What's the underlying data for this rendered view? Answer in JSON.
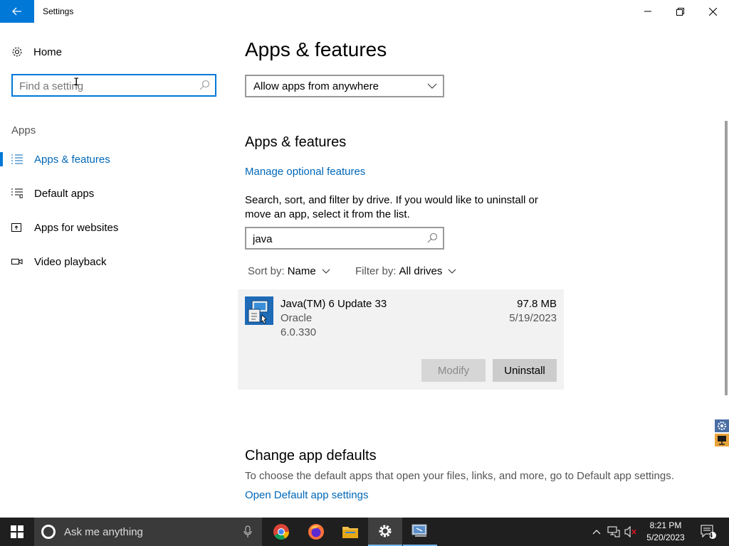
{
  "window": {
    "title": "Settings"
  },
  "sidebar": {
    "home_label": "Home",
    "search_placeholder": "Find a setting",
    "section_label": "Apps",
    "items": [
      {
        "label": "Apps & features",
        "active": true
      },
      {
        "label": "Default apps",
        "active": false
      },
      {
        "label": "Apps for websites",
        "active": false
      },
      {
        "label": "Video playback",
        "active": false
      }
    ]
  },
  "main": {
    "page_title": "Apps & features",
    "install_source": "Allow apps from anywhere",
    "section_heading": "Apps & features",
    "manage_link": "Manage optional features",
    "description": "Search, sort, and filter by drive. If you would like to uninstall or move an app, select it from the list.",
    "app_search_value": "java",
    "sort_label": "Sort by:",
    "sort_value": "Name",
    "filter_label": "Filter by:",
    "filter_value": "All drives",
    "apps": [
      {
        "name": "Java(TM) 6 Update 33",
        "publisher": "Oracle",
        "version": "6.0.330",
        "size": "97.8 MB",
        "date": "5/19/2023",
        "modify_label": "Modify",
        "uninstall_label": "Uninstall"
      }
    ],
    "defaults_heading": "Change app defaults",
    "defaults_desc": "To choose the default apps that open your files, links, and more, go to Default app settings.",
    "defaults_link": "Open Default app settings"
  },
  "taskbar": {
    "search_text": "Ask me anything",
    "clock_time": "8:21 PM",
    "clock_date": "5/20/2023",
    "notification_count": "4",
    "accent": "#76b9ed"
  },
  "colors": {
    "accent": "#0078d7",
    "link": "#0067b8"
  }
}
